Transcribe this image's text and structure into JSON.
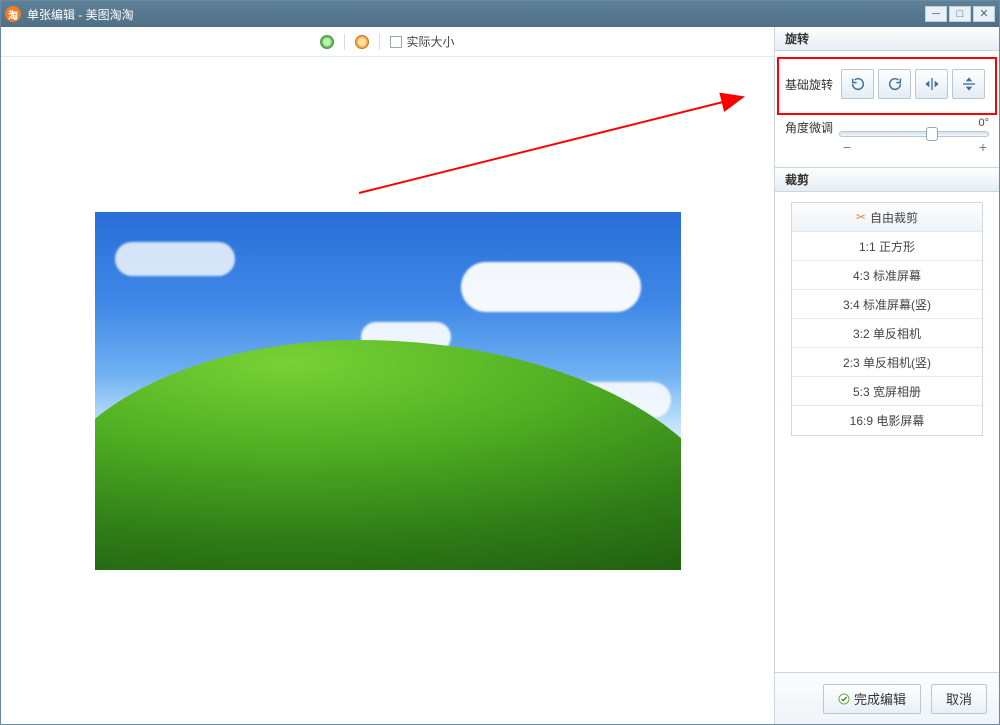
{
  "window": {
    "title": "单张编辑 - 美图淘淘"
  },
  "toolbar": {
    "actual_size_label": "实际大小"
  },
  "rotate": {
    "section_title": "旋转",
    "basic_label": "基础旋转",
    "fine_label": "角度微调",
    "degree_display": "0°",
    "slider_value": 0,
    "slider_min": -45,
    "slider_max": 45,
    "minus": "−",
    "plus": "+"
  },
  "crop": {
    "section_title": "裁剪",
    "items": [
      "自由裁剪",
      "1:1 正方形",
      "4:3 标准屏幕",
      "3:4 标准屏幕(竖)",
      "3:2 单反相机",
      "2:3 单反相机(竖)",
      "5:3 宽屏相册",
      "16:9 电影屏幕"
    ]
  },
  "footer": {
    "finish_label": "完成编辑",
    "cancel_label": "取消"
  }
}
